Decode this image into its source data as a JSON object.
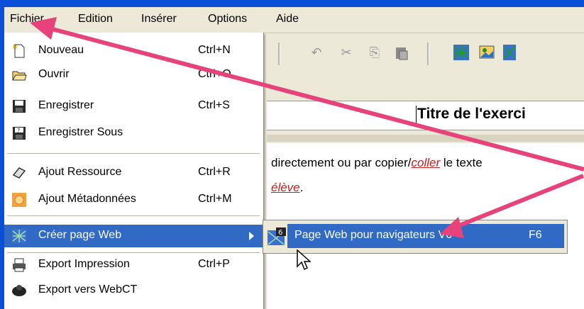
{
  "menubar": {
    "items": [
      "Fichier",
      "Edition",
      "Insérer",
      "Options",
      "Aide"
    ]
  },
  "menu": {
    "items": [
      {
        "label": "Nouveau",
        "shortcut": "Ctrl+N",
        "icon": "new-document-icon"
      },
      {
        "label": "Ouvrir",
        "shortcut": "Ctrl+O",
        "icon": "open-folder-icon"
      },
      {
        "label": "Enregistrer",
        "shortcut": "Ctrl+S",
        "icon": "save-disk-icon"
      },
      {
        "label": "Enregistrer Sous",
        "shortcut": "",
        "icon": "save-as-icon"
      },
      {
        "label": "Ajout Ressource",
        "shortcut": "Ctrl+R",
        "icon": "link-icon"
      },
      {
        "label": "Ajout Métadonnées",
        "shortcut": "Ctrl+M",
        "icon": "metadata-icon"
      },
      {
        "label": "Créer page Web",
        "shortcut": "",
        "icon": "web-page-icon"
      },
      {
        "label": "Export Impression",
        "shortcut": "Ctrl+P",
        "icon": "printer-icon"
      },
      {
        "label": "Export vers WebCT",
        "shortcut": "",
        "icon": "webct-icon"
      }
    ]
  },
  "submenu": {
    "label": "Page Web pour navigateurs V6",
    "shortcut": "F6",
    "icon_badge": "6"
  },
  "editor": {
    "title": "Titre de l'exerci",
    "line1_prefix": "directement ou par copier/",
    "line1_link": "coller",
    "line1_suffix": " le texte",
    "line2_link": "élève",
    "line2_suffix": "."
  },
  "colors": {
    "highlight": "#316ac5",
    "annotation_arrow": "#e8427a",
    "frame_blue": "#0a4fd8"
  }
}
